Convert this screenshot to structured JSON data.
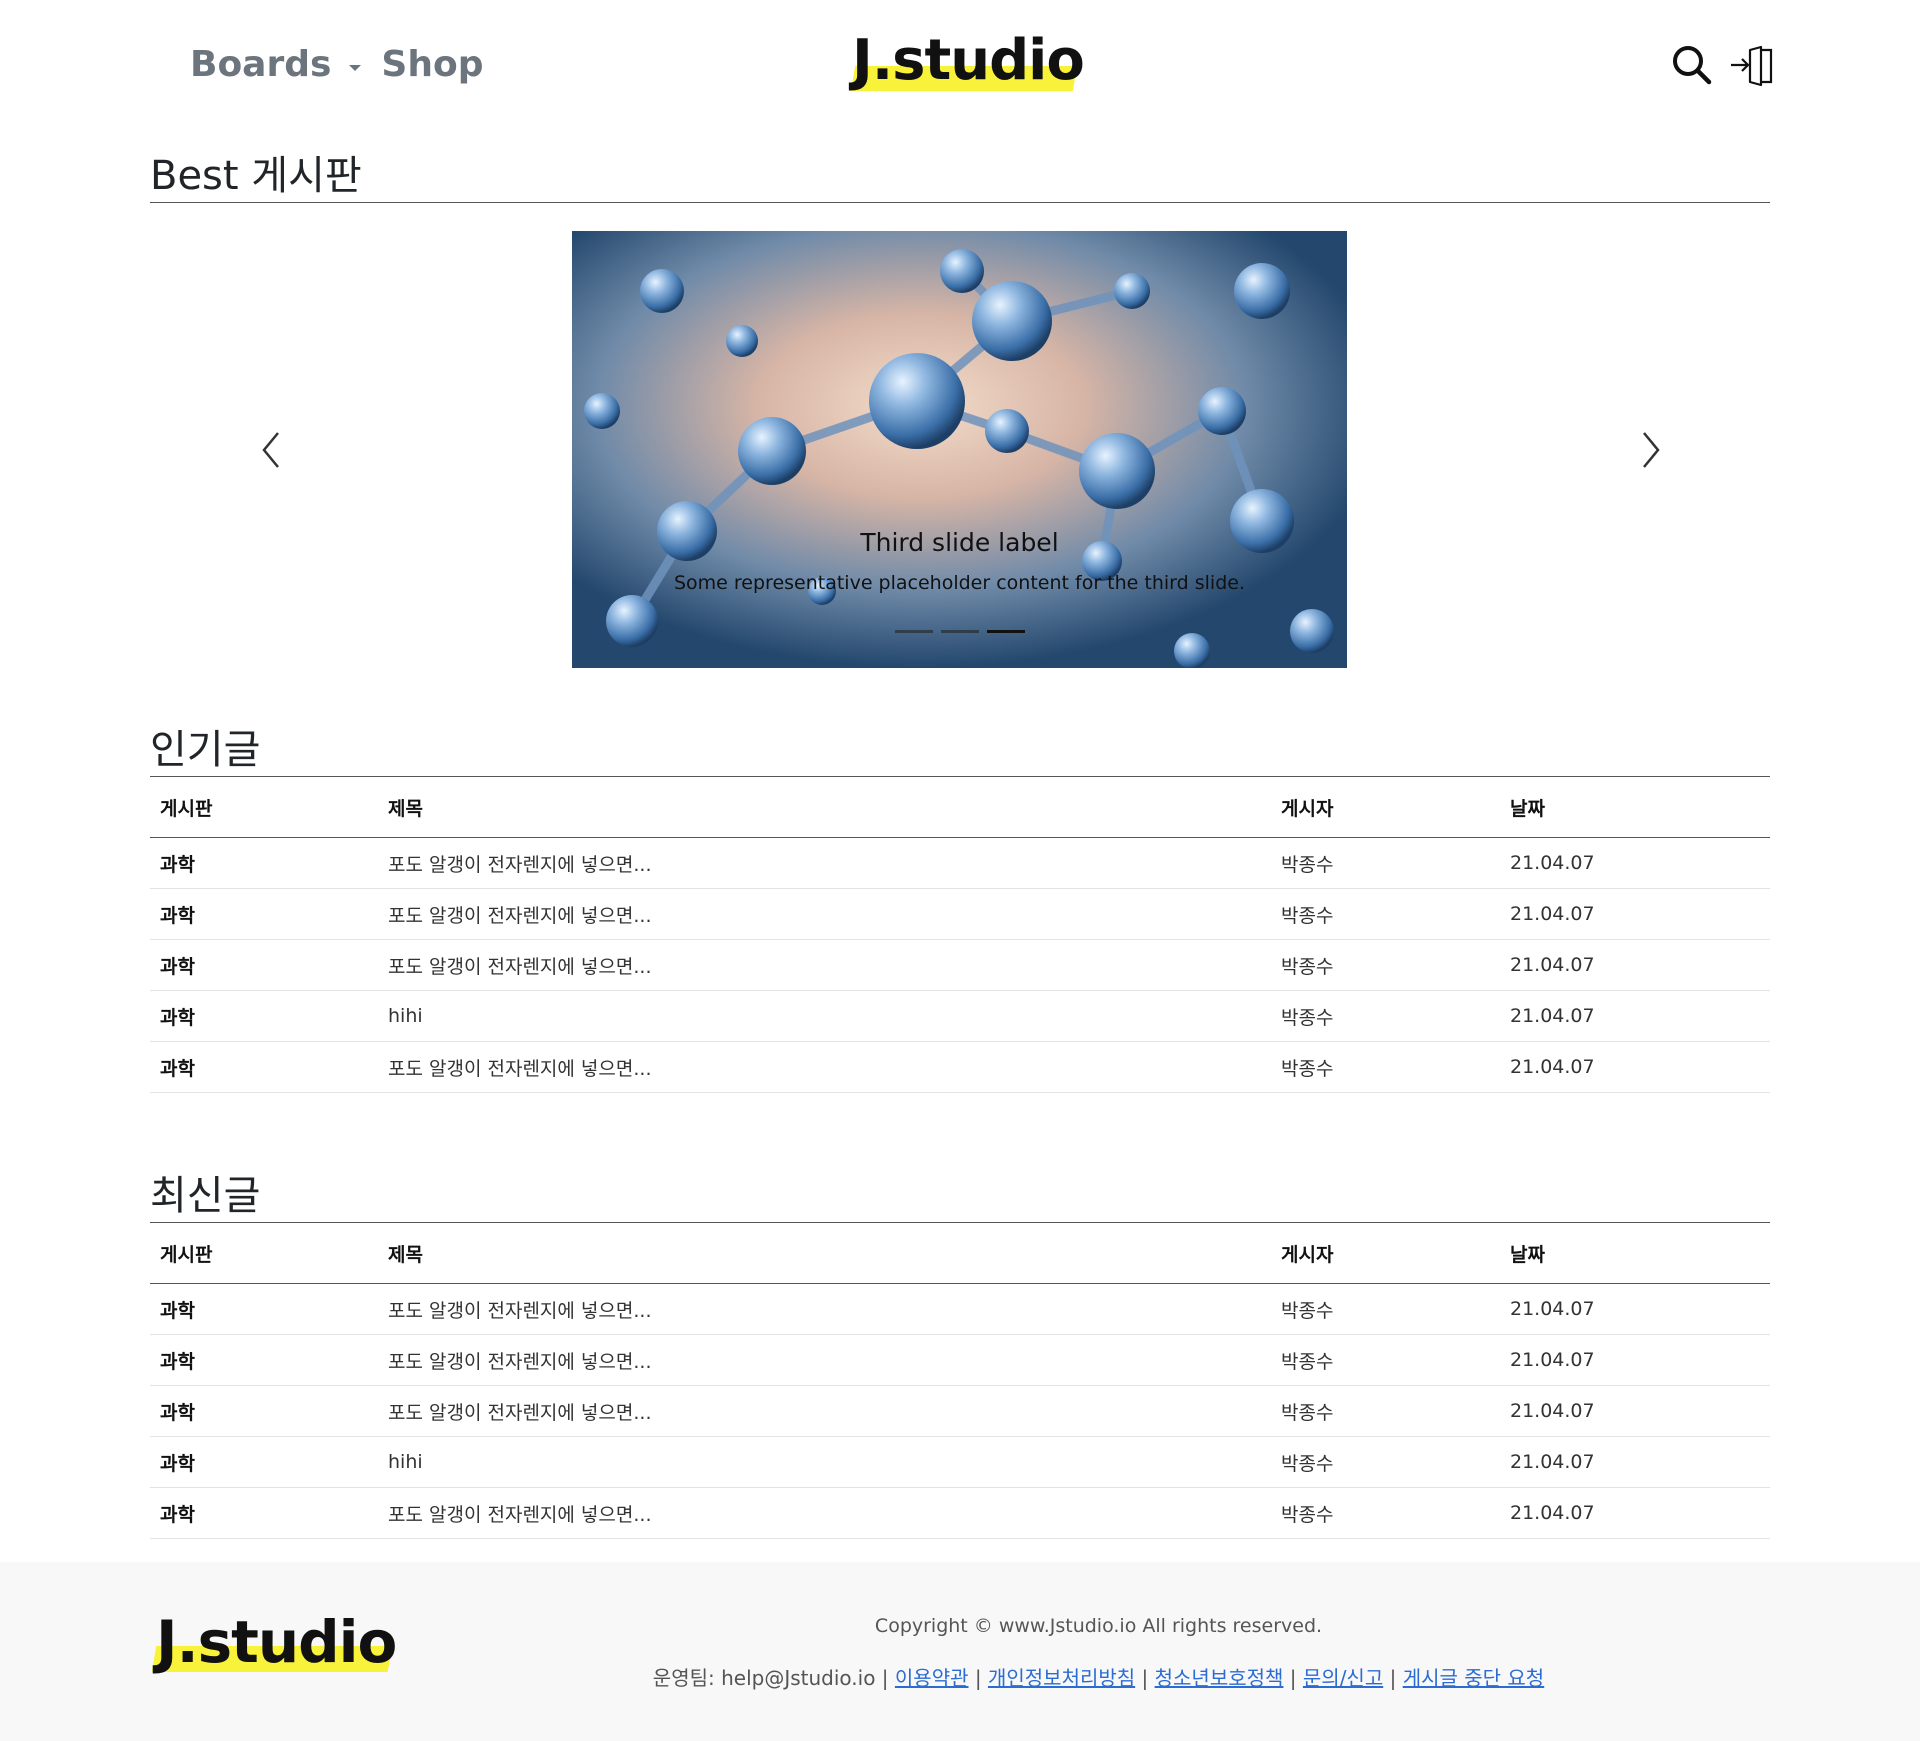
{
  "header": {
    "nav_boards": "Boards",
    "nav_shop": "Shop",
    "logo": "J.studio",
    "icons": [
      "search-icon",
      "login-icon"
    ],
    "accent": "#f9f23a"
  },
  "best": {
    "title": "Best 게시판",
    "caption_title": "Third slide label",
    "caption_text": "Some representative placeholder content for the third slide.",
    "active_slide_index": 2,
    "slides": 3
  },
  "popular": {
    "title": "인기글",
    "headers": [
      "게시판",
      "제목",
      "게시자",
      "날짜"
    ],
    "rows": [
      [
        "과학",
        "포도 알갱이 전자렌지에 넣으면...",
        "박종수",
        "21.04.07"
      ],
      [
        "과학",
        "포도 알갱이 전자렌지에 넣으면...",
        "박종수",
        "21.04.07"
      ],
      [
        "과학",
        "포도 알갱이 전자렌지에 넣으면...",
        "박종수",
        "21.04.07"
      ],
      [
        "과학",
        "hihi",
        "박종수",
        "21.04.07"
      ],
      [
        "과학",
        "포도 알갱이 전자렌지에 넣으면...",
        "박종수",
        "21.04.07"
      ]
    ]
  },
  "latest": {
    "title": "최신글",
    "headers": [
      "게시판",
      "제목",
      "게시자",
      "날짜"
    ],
    "rows": [
      [
        "과학",
        "포도 알갱이 전자렌지에 넣으면...",
        "박종수",
        "21.04.07"
      ],
      [
        "과학",
        "포도 알갱이 전자렌지에 넣으면...",
        "박종수",
        "21.04.07"
      ],
      [
        "과학",
        "포도 알갱이 전자렌지에 넣으면...",
        "박종수",
        "21.04.07"
      ],
      [
        "과학",
        "hihi",
        "박종수",
        "21.04.07"
      ],
      [
        "과학",
        "포도 알갱이 전자렌지에 넣으면...",
        "박종수",
        "21.04.07"
      ]
    ]
  },
  "footer": {
    "logo": "J.studio",
    "copyright": "Copyright © www.Jstudio.io All rights reserved.",
    "team": "운영팀: help@Jstudio.io",
    "links": [
      "이용약관",
      "개인정보처리방침",
      "청소년보호정책",
      "문의/신고",
      "게시글 중단 요청"
    ],
    "link_color": "#2b6cd4"
  }
}
